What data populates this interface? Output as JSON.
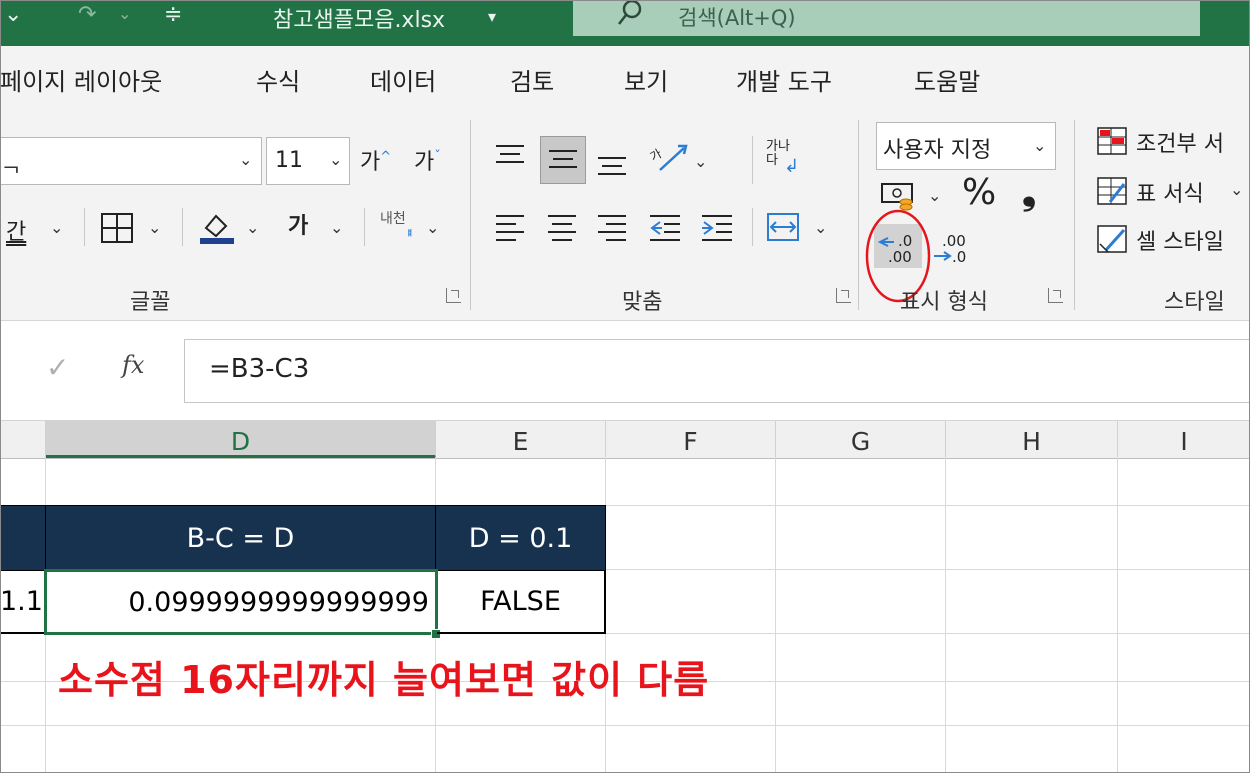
{
  "title_bar": {
    "filename": "참고샘플모음.xlsx",
    "search_placeholder": "검색(Alt+Q)"
  },
  "menu_tabs": [
    "페이지 레이아웃",
    "수식",
    "데이터",
    "검토",
    "보기",
    "개발 도구",
    "도움말"
  ],
  "ribbon": {
    "font_size": "11",
    "grow_font": "가",
    "shrink_font": "가",
    "bold_ga": "가",
    "font_color_ga": "가",
    "phonetic": "내천",
    "wrap_text": "가나다",
    "number_format": "사용자 지정",
    "percent": "%",
    "comma": "❟",
    "increase_decimal": ".0 .00",
    "decrease_decimal": ".00 .0",
    "styles": {
      "conditional": "조건부 서",
      "table": "표 서식",
      "cell": "셀 스타일"
    },
    "groups": {
      "font": "글꼴",
      "alignment": "맞춤",
      "number": "표시 형식",
      "styles": "스타일"
    }
  },
  "formula_bar": {
    "fx": "fx",
    "formula": "=B3-C3"
  },
  "columns": [
    "D",
    "E",
    "F",
    "G",
    "H",
    "I"
  ],
  "cells": {
    "d_header": "B-C = D",
    "e_header": "D = 0.1",
    "c_value": "1.1",
    "d_value": "0.0999999999999999",
    "e_value": "FALSE"
  },
  "annotation": "소수점 16자리까지 늘여보면 값이 다름",
  "colors": {
    "excel_green": "#217346",
    "header_fill": "#16324f",
    "annotation_red": "#e8141c"
  }
}
